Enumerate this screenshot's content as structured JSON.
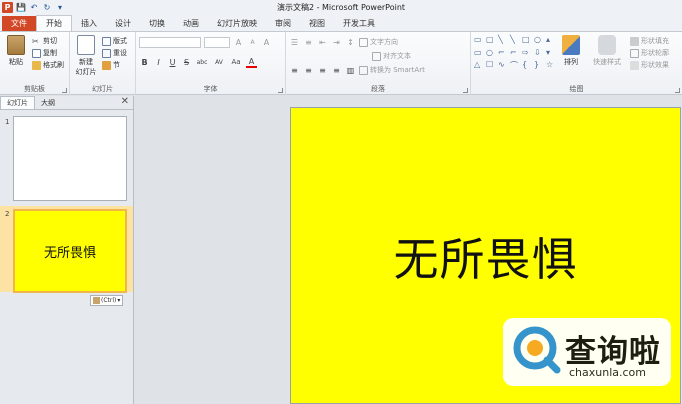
{
  "window": {
    "title": "演示文稿2 - Microsoft PowerPoint",
    "app_icon_letter": "P"
  },
  "quick_access": {
    "save": "💾",
    "undo": "↶",
    "redo": "↻",
    "customize": "▾"
  },
  "tabs": [
    {
      "label": "文件",
      "type": "file"
    },
    {
      "label": "开始",
      "active": true
    },
    {
      "label": "插入"
    },
    {
      "label": "设计"
    },
    {
      "label": "切换"
    },
    {
      "label": "动画"
    },
    {
      "label": "幻灯片放映"
    },
    {
      "label": "审阅"
    },
    {
      "label": "视图"
    },
    {
      "label": "开发工具"
    }
  ],
  "ribbon": {
    "clipboard": {
      "label": "剪贴板",
      "paste": "粘贴",
      "cut": "剪切",
      "copy": "复制",
      "format_painter": "格式刷"
    },
    "slides": {
      "label": "幻灯片",
      "new_slide": "新建",
      "new_slide2": "幻灯片",
      "layout": "版式",
      "reset": "重设",
      "section": "节"
    },
    "font": {
      "label": "字体",
      "bold": "B",
      "italic": "I",
      "underline": "U",
      "strike": "S",
      "shadow": "abc",
      "spacing": "AV",
      "case": "Aa",
      "color": "A",
      "grow": "A",
      "shrink": "A",
      "clear": "A"
    },
    "paragraph": {
      "label": "段落",
      "text_direction": "文字方向",
      "align_text": "对齐文本",
      "smartart": "转换为 SmartArt"
    },
    "drawing": {
      "label": "绘图",
      "arrange": "排列",
      "quick_styles": "快速样式",
      "fill": "形状填充",
      "outline": "形状轮廓",
      "effects": "形状效果"
    }
  },
  "left_panel": {
    "tabs": [
      {
        "label": "幻灯片",
        "active": true
      },
      {
        "label": "大纲"
      }
    ],
    "close": "✕",
    "slides": [
      {
        "number": "1",
        "text": ""
      },
      {
        "number": "2",
        "text": "无所畏惧"
      }
    ],
    "paste_options": "(Ctrl)"
  },
  "slide": {
    "text": "无所畏惧",
    "background": "#ffff00"
  },
  "watermark": {
    "cn": "查询啦",
    "en": "chaxunla.com"
  },
  "colors": {
    "file_tab": "#d24726",
    "slide_bg": "#ffff00",
    "selected_thumb_border": "#f0b64a",
    "logo_blue": "#2a8fd6"
  }
}
